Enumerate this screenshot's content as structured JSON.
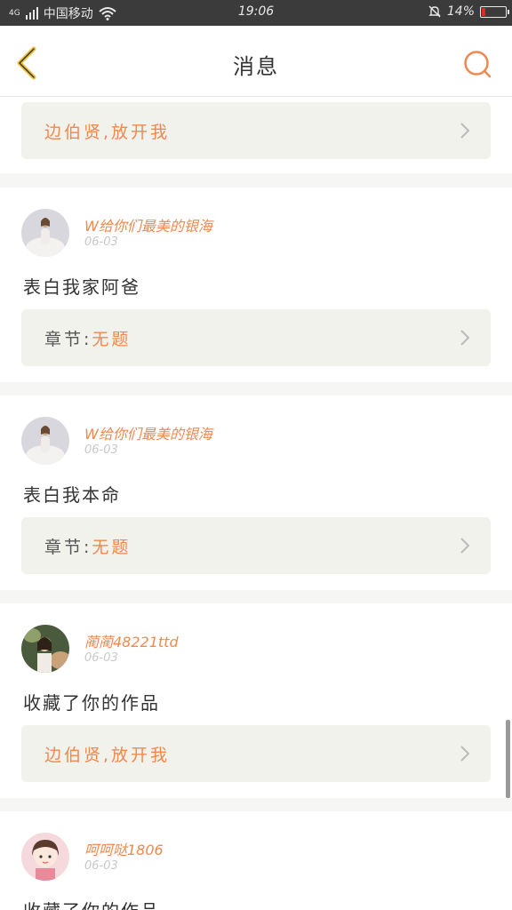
{
  "status_bar": {
    "network": "4G",
    "carrier": "中国移动",
    "time": "19:06",
    "battery": "14%",
    "battery_fraction": 0.14
  },
  "header": {
    "title": "消息",
    "back_icon": "chevron-left-icon",
    "search_icon": "search-icon",
    "accent_color": "#f0884f"
  },
  "items": [
    {
      "link_label": "",
      "link_value": "边伯贤,放开我"
    },
    {
      "user": "W给你们最美的银海",
      "date": "06-03",
      "message": "表白我家阿爸",
      "link_label": "章节:",
      "link_value": "无题"
    },
    {
      "user": "W给你们最美的银海",
      "date": "06-03",
      "message": "表白我本命",
      "link_label": "章节:",
      "link_value": "无题"
    },
    {
      "user": "蔺蔺48221ttd",
      "date": "06-03",
      "message": "收藏了你的作品",
      "link_label": "",
      "link_value": "边伯贤,放开我"
    },
    {
      "user": "呵呵哒1806",
      "date": "06-03",
      "message": "收藏了你的作品"
    }
  ]
}
